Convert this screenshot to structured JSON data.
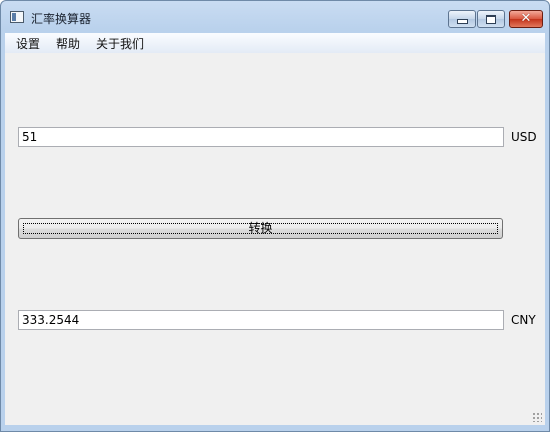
{
  "window": {
    "title": "汇率换算器",
    "close_symbol": "✕"
  },
  "menu": {
    "items": [
      "设置",
      "帮助",
      "关于我们"
    ]
  },
  "converter": {
    "input_value": "51",
    "from_currency": "USD",
    "convert_label": "转换",
    "output_value": "333.2544",
    "to_currency": "CNY"
  },
  "colors": {
    "titlebar": "#b9d1ec",
    "client_background": "#f0f0f0",
    "close_button": "#c2331b"
  }
}
